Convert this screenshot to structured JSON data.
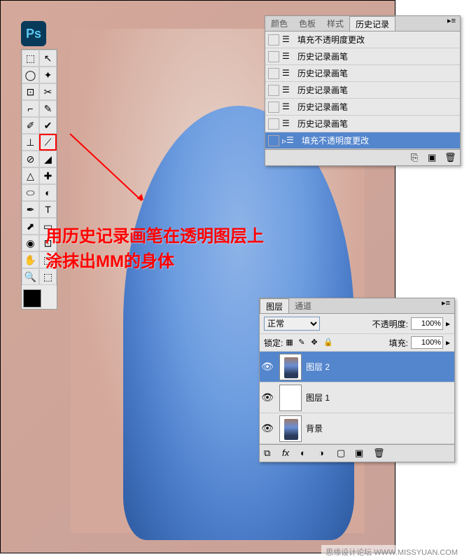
{
  "ps_logo": "Ps",
  "annotation": {
    "line1": "用历史记录画笔在透明图层上",
    "line2": "涂抹出MM的身体"
  },
  "history_panel": {
    "tabs": [
      "颜色",
      "色板",
      "样式",
      "历史记录"
    ],
    "active_tab": 3,
    "items": [
      {
        "label": "填充不透明度更改",
        "selected": false
      },
      {
        "label": "历史记录画笔",
        "selected": false
      },
      {
        "label": "历史记录画笔",
        "selected": false
      },
      {
        "label": "历史记录画笔",
        "selected": false
      },
      {
        "label": "历史记录画笔",
        "selected": false
      },
      {
        "label": "历史记录画笔",
        "selected": false
      },
      {
        "label": "填充不透明度更改",
        "selected": true
      }
    ]
  },
  "layers_panel": {
    "tabs": [
      "图层",
      "通道"
    ],
    "active_tab": 0,
    "blend_mode": "正常",
    "opacity_label": "不透明度:",
    "opacity_value": "100%",
    "lock_label": "锁定:",
    "fill_label": "填充:",
    "fill_value": "100%",
    "layers": [
      {
        "name": "图层 2",
        "visible": true,
        "selected": true,
        "thumb": "person"
      },
      {
        "name": "图层 1",
        "visible": true,
        "selected": false,
        "thumb": "white"
      },
      {
        "name": "背景",
        "visible": true,
        "selected": false,
        "thumb": "person"
      }
    ]
  },
  "tools": [
    [
      "⬚",
      "↖"
    ],
    [
      "◯",
      "✦"
    ],
    [
      "⊡",
      "✂"
    ],
    [
      "⌐",
      "✎"
    ],
    [
      "✐",
      "✔"
    ],
    [
      "⊥",
      "⟋"
    ],
    [
      "⊘",
      "◢"
    ],
    [
      "△",
      "✚"
    ],
    [
      "⬭",
      "◐"
    ],
    [
      "✒",
      "T"
    ],
    [
      "⬈",
      "▭"
    ],
    [
      "◉",
      "⊡"
    ],
    [
      "✋",
      "⬚"
    ],
    [
      "🔍",
      "⬚"
    ]
  ],
  "highlighted_tool_row": 5,
  "highlighted_tool_col": 1,
  "watermark": "思缘设计论坛    WWW.MISSYUAN.COM"
}
